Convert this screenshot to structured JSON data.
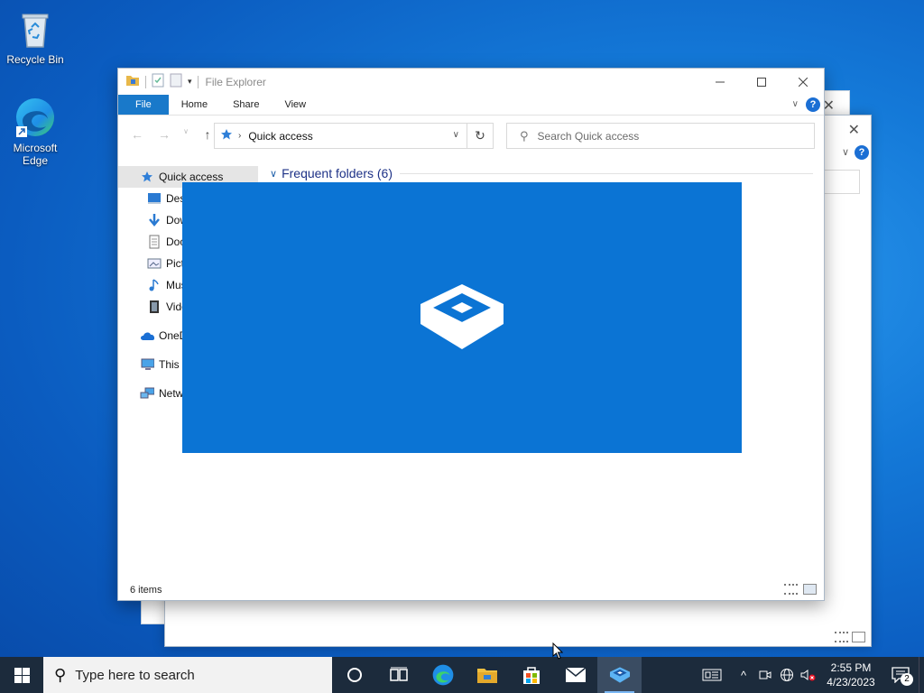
{
  "desktop": {
    "icons": [
      {
        "label": "Recycle Bin",
        "icon": "recycle-bin-icon"
      },
      {
        "label": "Microsoft Edge",
        "icon": "edge-icon"
      }
    ]
  },
  "explorer": {
    "title": "File Explorer",
    "ribbon_tabs": [
      "File",
      "Home",
      "Share",
      "View"
    ],
    "address": "Quick access",
    "search_placeholder": "Search Quick access",
    "section_header": "Frequent folders (6)",
    "nav_items": [
      "Quick access",
      "Desktop",
      "Downloads",
      "Documents",
      "Pictures",
      "Music",
      "Videos",
      "OneDrive",
      "This PC",
      "Network"
    ],
    "status": "6 items",
    "accent": "#1979ca"
  },
  "splash": {
    "icon": "sandbox-icon",
    "background": "#0b74d4"
  },
  "taskbar": {
    "search_placeholder": "Type here to search",
    "apps": [
      "cortana-icon",
      "task-view-icon",
      "edge-icon",
      "file-explorer-icon",
      "store-icon",
      "mail-icon",
      "sandbox-icon"
    ],
    "time": "2:55 PM",
    "date": "4/23/2023",
    "notification_count": "2"
  }
}
